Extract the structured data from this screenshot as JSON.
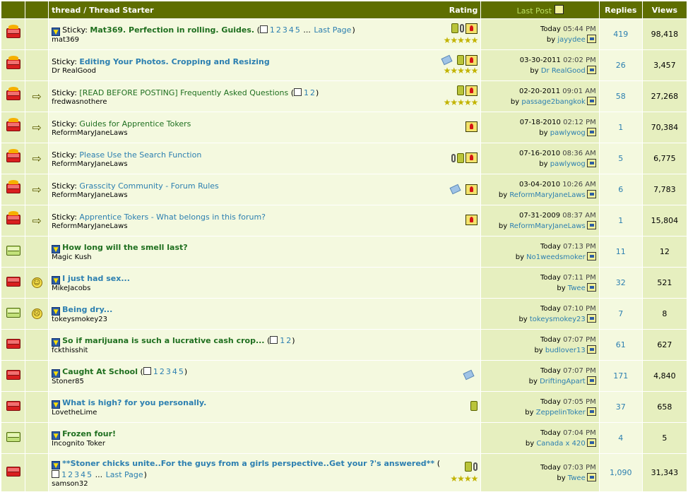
{
  "header": {
    "thread_starter": "thread / Thread Starter",
    "rating": "Rating",
    "last_post": "Last Post",
    "replies": "Replies",
    "views": "Views"
  },
  "labels": {
    "by": "by",
    "sticky": "Sticky:",
    "last_page": "Last Page"
  },
  "threads": [
    {
      "icon": "flame",
      "emote": "",
      "sticky": true,
      "newpost": true,
      "title": "Mat369. Perfection in rolling. Guides.",
      "titleStyle": "green-bold",
      "pages": [
        "1",
        "2",
        "3",
        "4",
        "5"
      ],
      "ellipsis": true,
      "lastPage": true,
      "starter": "mat369",
      "icons": [
        "bin",
        "clip",
        "pin"
      ],
      "stars": 5,
      "lpdate": "Today",
      "lptime": "05:44 PM",
      "lpuser": "jayydee",
      "replies": "419",
      "views": "98,418"
    },
    {
      "icon": "flame",
      "emote": "",
      "sticky": true,
      "newpost": false,
      "title": "Editing Your Photos. Cropping and Resizing",
      "titleStyle": "blue-bold",
      "pages": [],
      "starter": "Dr RealGood",
      "icons": [
        "tag",
        "bin",
        "pin"
      ],
      "stars": 5,
      "lpdate": "03-30-2011",
      "lptime": "02:02 PM",
      "lpuser": "Dr RealGood",
      "replies": "26",
      "views": "3,457"
    },
    {
      "icon": "flame",
      "emote": "arrow",
      "sticky": true,
      "newpost": false,
      "title": "[READ BEFORE POSTING] Frequently Asked Questions",
      "titleStyle": "green",
      "pages": [
        "1",
        "2"
      ],
      "starter": "fredwasnothere",
      "icons": [
        "bin",
        "pin"
      ],
      "stars": 5,
      "lpdate": "02-20-2011",
      "lptime": "09:01 AM",
      "lpuser": "passage2bangkok",
      "replies": "58",
      "views": "27,268"
    },
    {
      "icon": "flame",
      "emote": "arrow",
      "sticky": true,
      "newpost": false,
      "title": "Guides for Apprentice Tokers",
      "titleStyle": "green",
      "pages": [],
      "starter": "ReformMaryJaneLaws",
      "icons": [
        "pin"
      ],
      "stars": 0,
      "lpdate": "07-18-2010",
      "lptime": "02:12 PM",
      "lpuser": "pawlywog",
      "replies": "1",
      "views": "70,384"
    },
    {
      "icon": "flame",
      "emote": "arrow",
      "sticky": true,
      "newpost": false,
      "title": "Please Use the Search Function",
      "titleStyle": "blue",
      "pages": [],
      "starter": "ReformMaryJaneLaws",
      "icons": [
        "clip",
        "bin",
        "pin"
      ],
      "stars": 0,
      "lpdate": "07-16-2010",
      "lptime": "08:36 AM",
      "lpuser": "pawlywog",
      "replies": "5",
      "views": "6,775"
    },
    {
      "icon": "flame",
      "emote": "arrow",
      "sticky": true,
      "newpost": false,
      "title": "Grasscity Community - Forum Rules",
      "titleStyle": "blue",
      "pages": [],
      "starter": "ReformMaryJaneLaws",
      "icons": [
        "tag",
        "pin"
      ],
      "stars": 0,
      "lpdate": "03-04-2010",
      "lptime": "10:26 AM",
      "lpuser": "ReformMaryJaneLaws",
      "replies": "6",
      "views": "7,783"
    },
    {
      "icon": "flame",
      "emote": "arrow",
      "sticky": true,
      "newpost": false,
      "title": "Apprentice Tokers - What belongs in this forum?",
      "titleStyle": "blue",
      "pages": [],
      "starter": "ReformMaryJaneLaws",
      "icons": [
        "pin"
      ],
      "stars": 0,
      "lpdate": "07-31-2009",
      "lptime": "08:37 AM",
      "lpuser": "ReformMaryJaneLaws",
      "replies": "1",
      "views": "15,804"
    },
    {
      "icon": "green",
      "emote": "",
      "sticky": false,
      "newpost": true,
      "title": "How long will the smell last?",
      "titleStyle": "green-bold",
      "pages": [],
      "starter": "Magic Kush",
      "icons": [],
      "stars": 0,
      "lpdate": "Today",
      "lptime": "07:13 PM",
      "lpuser": "No1weedsmoker",
      "replies": "11",
      "views": "12"
    },
    {
      "icon": "red",
      "emote": "smile",
      "sticky": false,
      "newpost": true,
      "title": "I just had sex...",
      "titleStyle": "blue-bold",
      "pages": [],
      "starter": "MikeJacobs",
      "icons": [],
      "stars": 0,
      "lpdate": "Today",
      "lptime": "07:11 PM",
      "lpuser": "Twee",
      "replies": "32",
      "views": "521"
    },
    {
      "icon": "green",
      "emote": "sad",
      "sticky": false,
      "newpost": true,
      "title": "Being dry...",
      "titleStyle": "blue-bold",
      "pages": [],
      "starter": "tokeysmokey23",
      "icons": [],
      "stars": 0,
      "lpdate": "Today",
      "lptime": "07:10 PM",
      "lpuser": "tokeysmokey23",
      "replies": "7",
      "views": "8"
    },
    {
      "icon": "red",
      "emote": "",
      "sticky": false,
      "newpost": true,
      "title": "So if marijuana is such a lucrative cash crop...",
      "titleStyle": "green-bold",
      "pages": [
        "1",
        "2"
      ],
      "starter": "fckthisshit",
      "icons": [],
      "stars": 0,
      "lpdate": "Today",
      "lptime": "07:07 PM",
      "lpuser": "budlover13",
      "replies": "61",
      "views": "627"
    },
    {
      "icon": "red",
      "emote": "",
      "sticky": false,
      "newpost": true,
      "title": "Caught At School",
      "titleStyle": "green-bold",
      "pages": [
        "1",
        "2",
        "3",
        "4",
        "5"
      ],
      "starter": "Stoner85",
      "icons": [
        "tag"
      ],
      "stars": 0,
      "lpdate": "Today",
      "lptime": "07:07 PM",
      "lpuser": "DriftingApart",
      "replies": "171",
      "views": "4,840"
    },
    {
      "icon": "red",
      "emote": "",
      "sticky": false,
      "newpost": true,
      "title": "What is high? for you personally.",
      "titleStyle": "blue-bold",
      "pages": [],
      "starter": "LovetheLime",
      "icons": [
        "bin"
      ],
      "stars": 0,
      "lpdate": "Today",
      "lptime": "07:05 PM",
      "lpuser": "ZeppelinToker",
      "replies": "37",
      "views": "658"
    },
    {
      "icon": "green",
      "emote": "",
      "sticky": false,
      "newpost": true,
      "title": "Frozen four!",
      "titleStyle": "green-bold",
      "pages": [],
      "starter": "Incognito Toker",
      "icons": [],
      "stars": 0,
      "lpdate": "Today",
      "lptime": "07:04 PM",
      "lpuser": "Canada x 420",
      "replies": "4",
      "views": "5"
    },
    {
      "icon": "red",
      "emote": "",
      "sticky": false,
      "newpost": true,
      "title": "**Stoner chicks unite..For the guys from a girls perspective..Get your ?'s answered**",
      "titleStyle": "blue-bold",
      "pages": [
        "1",
        "2",
        "3",
        "4",
        "5"
      ],
      "ellipsis": true,
      "lastPage": true,
      "starter": "samson32",
      "icons": [
        "bin",
        "clip"
      ],
      "stars": 4,
      "lpdate": "Today",
      "lptime": "07:03 PM",
      "lpuser": "Twee",
      "replies": "1,090",
      "views": "31,343"
    }
  ]
}
